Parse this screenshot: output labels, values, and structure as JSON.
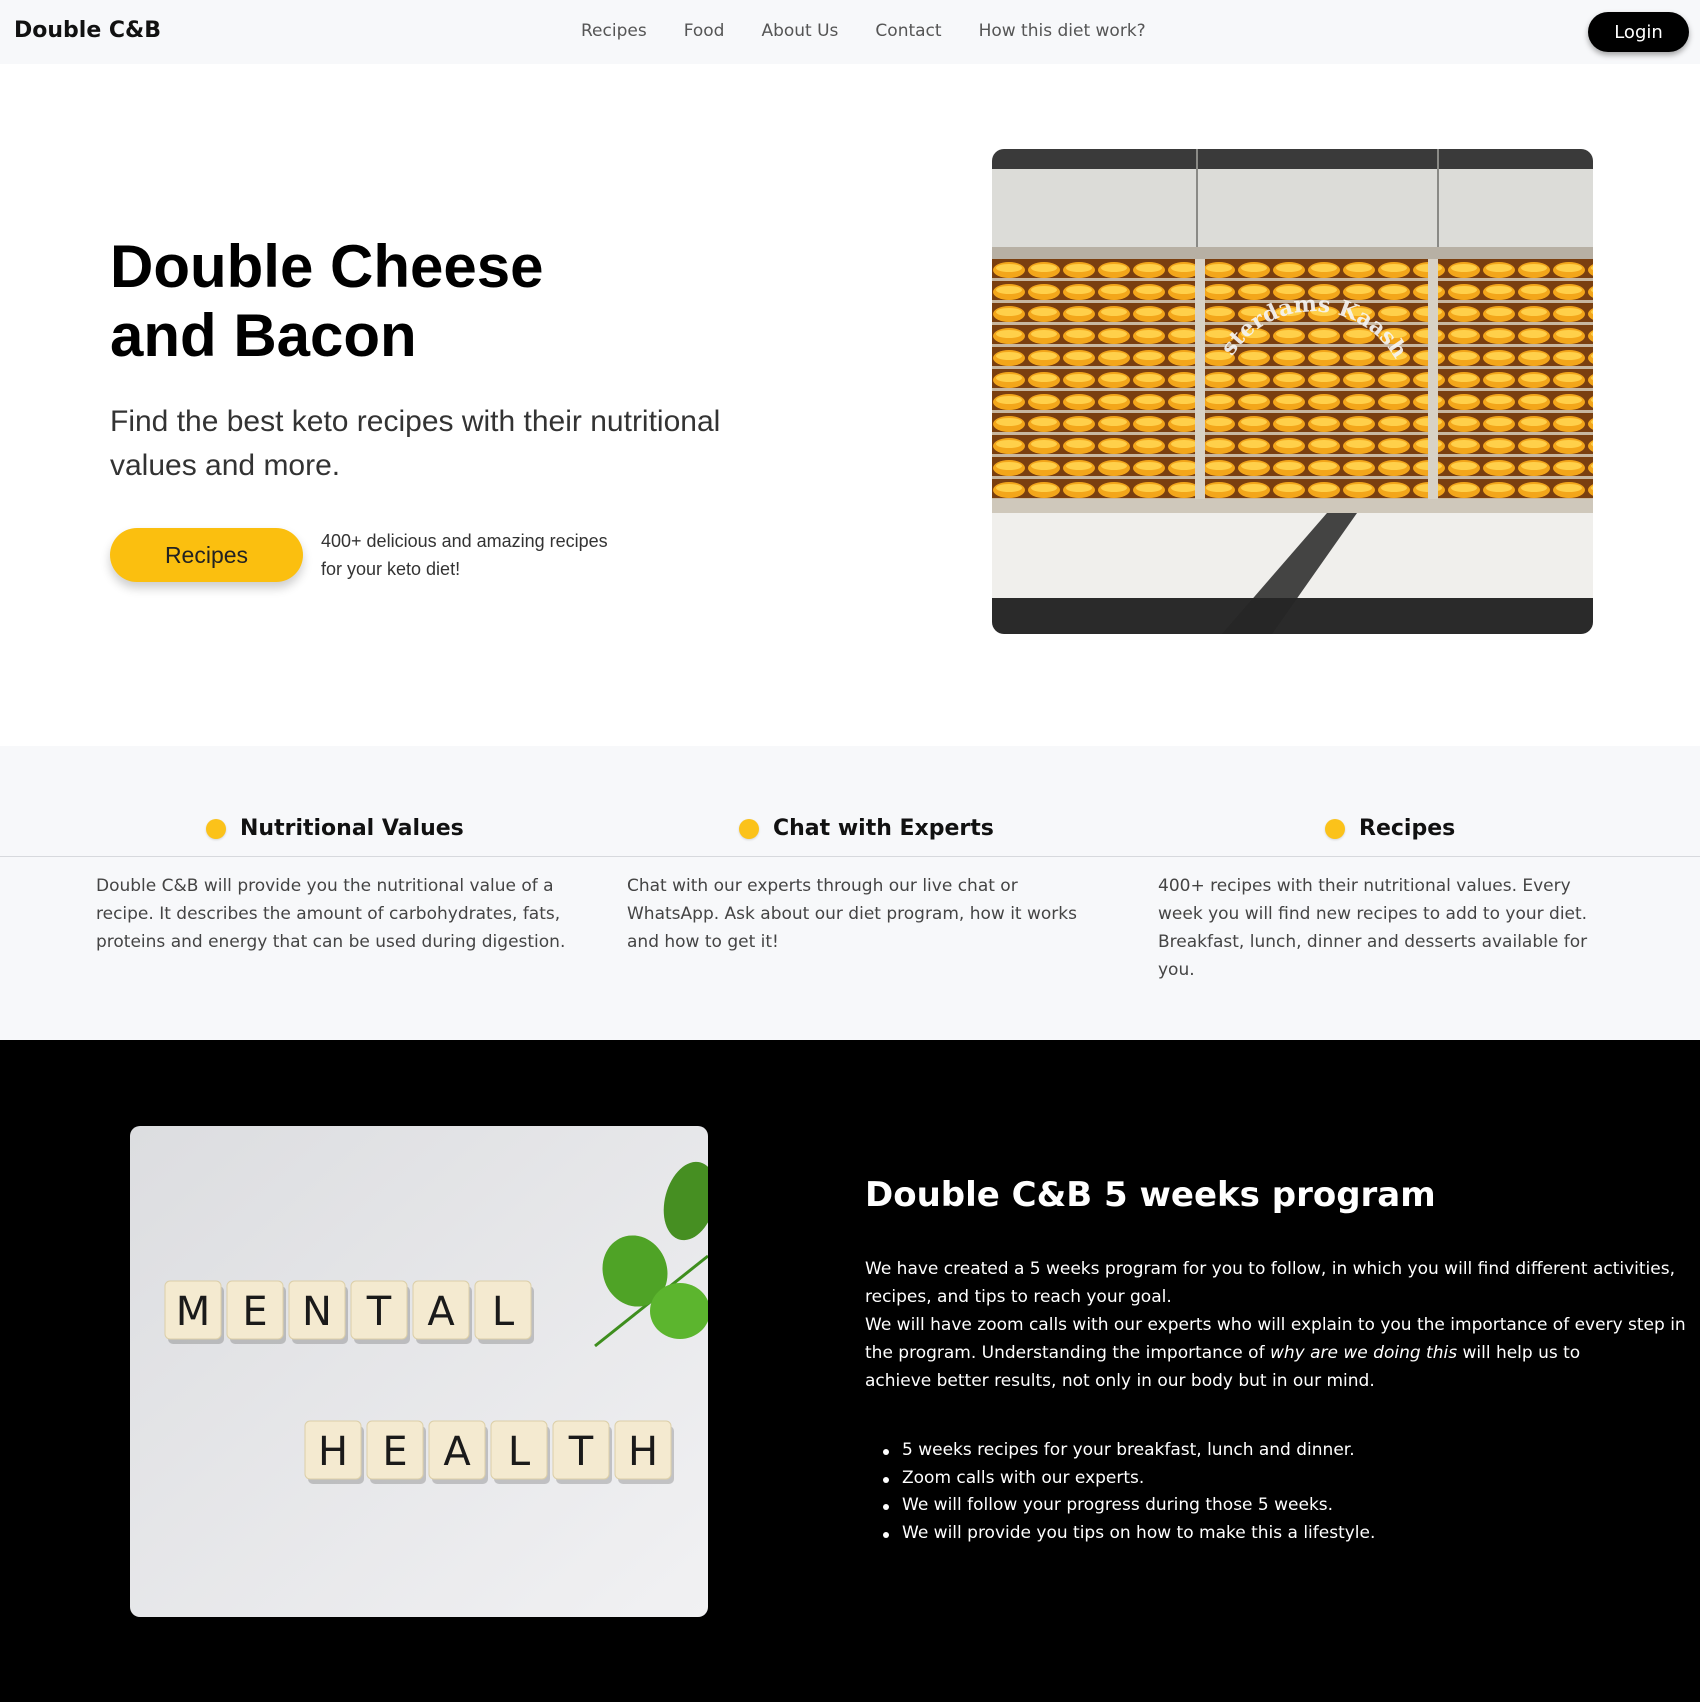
{
  "nav": {
    "brand": "Double C&B",
    "links": [
      "Recipes",
      "Food",
      "About Us",
      "Contact",
      "How this diet work?"
    ],
    "login_label": "Login"
  },
  "hero": {
    "title_line1": "Double Cheese",
    "title_line2": "and Bacon",
    "subtitle": "Find the best keto recipes with their nutritional values and more.",
    "button_label": "Recipes",
    "note_line1": "400+ delicious and amazing recipes",
    "note_line2": "for your keto diet!",
    "image_sign": "Amsterdams Kaashuis"
  },
  "features": [
    {
      "title": "Nutritional Values",
      "text": "Double C&B will provide you the nutritional value of a recipe. It describes the amount of carbohydrates, fats, proteins and energy that can be used during digestion."
    },
    {
      "title": "Chat with Experts",
      "text": "Chat with our experts through our live chat or WhatsApp. Ask about our diet program, how it works and how to get it!"
    },
    {
      "title": "Recipes",
      "text": "400+ recipes with their nutritional values. Every week you will find new recipes to add to your diet. Breakfast, lunch, dinner and desserts available for you."
    }
  ],
  "program": {
    "title": "Double C&B 5 weeks program",
    "desc_p1": "We have created a 5 weeks program for you to follow, in which you will find different activities, recipes, and tips to reach your goal.",
    "desc_p2a": "We will have zoom calls with our experts who will explain to you the importance of every step in the program. Understanding the importance of ",
    "desc_p2_italic": "why are we doing this",
    "desc_p2b": " will help us to",
    "desc_p3": "achieve better results, not only in our body but in our mind.",
    "bullets": [
      "5 weeks recipes for your breakfast, lunch and dinner.",
      "Zoom calls with our experts.",
      "We will follow your progress during those 5 weeks.",
      "We will provide you tips on how to make this a lifestyle."
    ],
    "tiles_word1": [
      "M",
      "E",
      "N",
      "T",
      "A",
      "L"
    ],
    "tiles_word2": [
      "H",
      "E",
      "A",
      "L",
      "T",
      "H"
    ]
  },
  "colors": {
    "accent": "#fbbf0f",
    "nav_bg": "#f7f8fa",
    "program_bg": "#000000"
  }
}
